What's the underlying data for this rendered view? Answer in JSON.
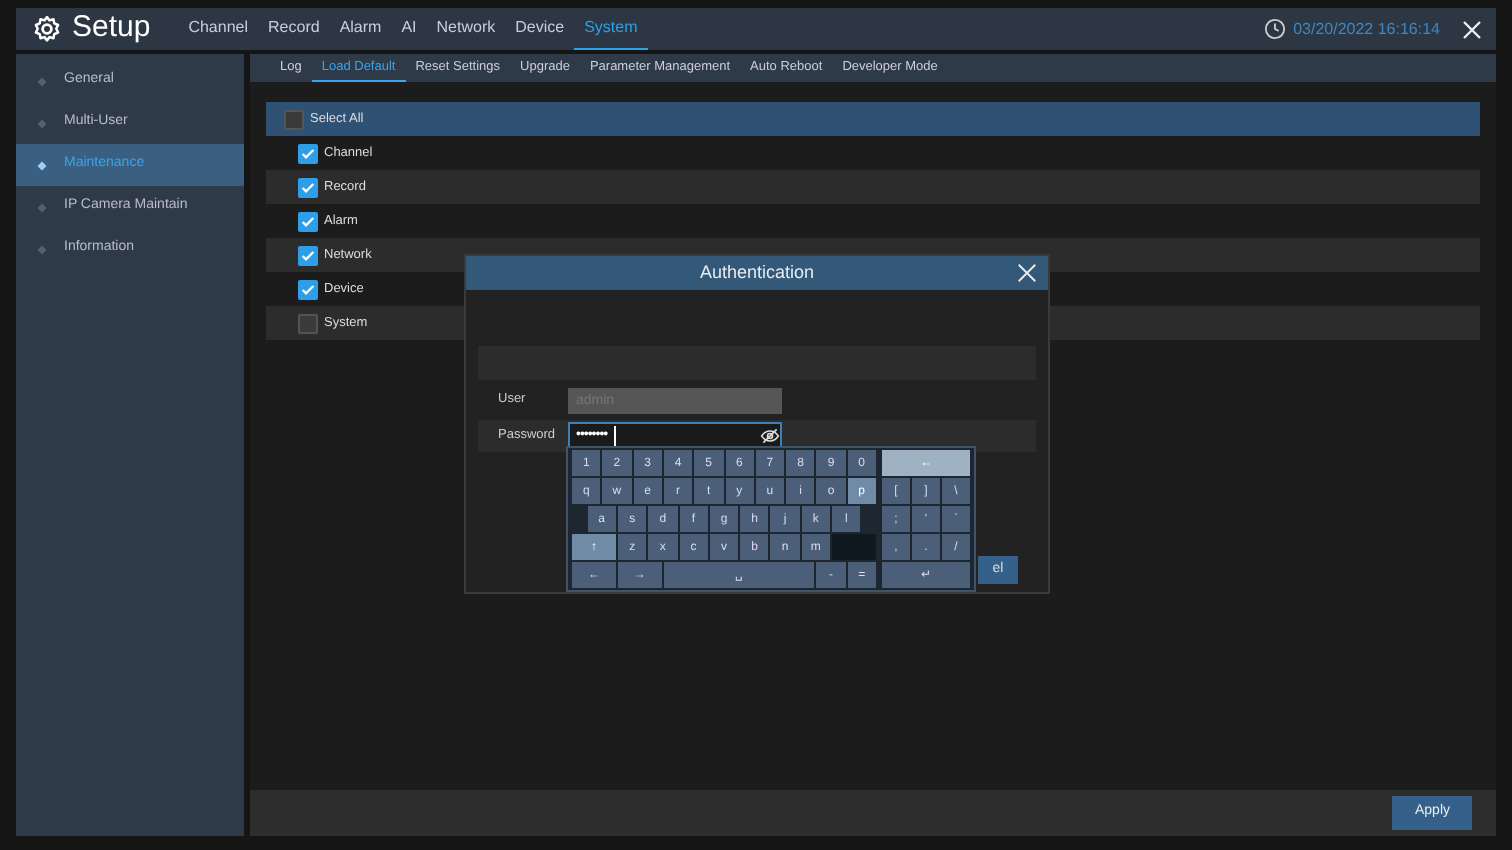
{
  "header": {
    "title": "Setup",
    "tabs": [
      {
        "label": "Channel",
        "selected": false
      },
      {
        "label": "Record",
        "selected": false
      },
      {
        "label": "Alarm",
        "selected": false
      },
      {
        "label": "AI",
        "selected": false
      },
      {
        "label": "Network",
        "selected": false
      },
      {
        "label": "Device",
        "selected": false
      },
      {
        "label": "System",
        "selected": true
      }
    ],
    "datetime": "03/20/2022 16:16:14"
  },
  "sidebar": {
    "items": [
      {
        "label": "General",
        "selected": false
      },
      {
        "label": "Multi-User",
        "selected": false
      },
      {
        "label": "Maintenance",
        "selected": true
      },
      {
        "label": "IP Camera Maintain",
        "selected": false
      },
      {
        "label": "Information",
        "selected": false
      }
    ]
  },
  "subtabs": [
    {
      "label": "Log",
      "selected": false
    },
    {
      "label": "Load Default",
      "selected": true
    },
    {
      "label": "Reset Settings",
      "selected": false
    },
    {
      "label": "Upgrade",
      "selected": false
    },
    {
      "label": "Parameter Management",
      "selected": false
    },
    {
      "label": "Auto Reboot",
      "selected": false
    },
    {
      "label": "Developer Mode",
      "selected": false
    }
  ],
  "options": [
    {
      "label": "Select All",
      "checked": false,
      "kind": "all"
    },
    {
      "label": "Channel",
      "checked": true,
      "kind": "item"
    },
    {
      "label": "Record",
      "checked": true,
      "kind": "item"
    },
    {
      "label": "Alarm",
      "checked": true,
      "kind": "item"
    },
    {
      "label": "Network",
      "checked": true,
      "kind": "item"
    },
    {
      "label": "Device",
      "checked": true,
      "kind": "item"
    },
    {
      "label": "System",
      "checked": false,
      "kind": "item"
    }
  ],
  "dialog": {
    "title": "Authentication",
    "user": {
      "label": "User",
      "value": "admin",
      "disabled": true
    },
    "password": {
      "label": "Password",
      "value": "••••••••",
      "disabled": false
    },
    "cancel_button": "el",
    "keyboard": {
      "left_rows": [
        [
          {
            "label": "1",
            "kind": "char",
            "highlighted": false
          },
          {
            "label": "2",
            "kind": "char",
            "highlighted": false
          },
          {
            "label": "3",
            "kind": "char",
            "highlighted": false
          },
          {
            "label": "4",
            "kind": "char",
            "highlighted": false
          },
          {
            "label": "5",
            "kind": "char",
            "highlighted": false
          },
          {
            "label": "6",
            "kind": "char",
            "highlighted": false
          },
          {
            "label": "7",
            "kind": "char",
            "highlighted": false
          },
          {
            "label": "8",
            "kind": "char",
            "highlighted": false
          },
          {
            "label": "9",
            "kind": "char",
            "highlighted": false
          },
          {
            "label": "0",
            "kind": "char",
            "highlighted": false
          }
        ],
        [
          {
            "label": "q",
            "kind": "char",
            "highlighted": false
          },
          {
            "label": "w",
            "kind": "char",
            "highlighted": false
          },
          {
            "label": "e",
            "kind": "char",
            "highlighted": false
          },
          {
            "label": "r",
            "kind": "char",
            "highlighted": false
          },
          {
            "label": "t",
            "kind": "char",
            "highlighted": false
          },
          {
            "label": "y",
            "kind": "char",
            "highlighted": false
          },
          {
            "label": "u",
            "kind": "char",
            "highlighted": false
          },
          {
            "label": "i",
            "kind": "char",
            "highlighted": false
          },
          {
            "label": "o",
            "kind": "char",
            "highlighted": false
          },
          {
            "label": "p",
            "kind": "char",
            "highlighted": true
          }
        ],
        [
          {
            "kind": "gap"
          },
          {
            "label": "a",
            "kind": "char",
            "highlighted": false
          },
          {
            "label": "s",
            "kind": "char",
            "highlighted": false
          },
          {
            "label": "d",
            "kind": "char",
            "highlighted": false
          },
          {
            "label": "f",
            "kind": "char",
            "highlighted": false
          },
          {
            "label": "g",
            "kind": "char",
            "highlighted": false
          },
          {
            "label": "h",
            "kind": "char",
            "highlighted": false
          },
          {
            "label": "j",
            "kind": "char",
            "highlighted": false
          },
          {
            "label": "k",
            "kind": "char",
            "highlighted": false
          },
          {
            "label": "l",
            "kind": "char",
            "highlighted": false
          },
          {
            "kind": "gap"
          }
        ],
        [
          {
            "label": "↑",
            "kind": "shift",
            "highlighted": true
          },
          {
            "label": "z",
            "kind": "char",
            "highlighted": false
          },
          {
            "label": "x",
            "kind": "char",
            "highlighted": false
          },
          {
            "label": "c",
            "kind": "char",
            "highlighted": false
          },
          {
            "label": "v",
            "kind": "char",
            "highlighted": false
          },
          {
            "label": "b",
            "kind": "char",
            "highlighted": false
          },
          {
            "label": "n",
            "kind": "char",
            "highlighted": false
          },
          {
            "label": "m",
            "kind": "char",
            "highlighted": false
          },
          {
            "kind": "blank"
          }
        ],
        [
          {
            "label": "←",
            "kind": "arrow",
            "highlighted": false
          },
          {
            "label": "→",
            "kind": "arrow",
            "highlighted": false
          },
          {
            "label": "␣",
            "kind": "space",
            "highlighted": false
          },
          {
            "label": "-",
            "kind": "char",
            "highlighted": false
          },
          {
            "label": "=",
            "kind": "char",
            "highlighted": false
          }
        ]
      ],
      "right_rows": [
        [
          {
            "label": "←",
            "kind": "wide",
            "highlighted": true
          }
        ],
        [
          {
            "label": "[",
            "kind": "char",
            "highlighted": false
          },
          {
            "label": "]",
            "kind": "char",
            "highlighted": false
          },
          {
            "label": "\\",
            "kind": "char",
            "highlighted": false
          }
        ],
        [
          {
            "label": ";",
            "kind": "char",
            "highlighted": false
          },
          {
            "label": "'",
            "kind": "char",
            "highlighted": false
          },
          {
            "label": "`",
            "kind": "char",
            "highlighted": false
          }
        ],
        [
          {
            "label": ",",
            "kind": "char",
            "highlighted": false
          },
          {
            "label": ".",
            "kind": "char",
            "highlighted": false
          },
          {
            "label": "/",
            "kind": "char",
            "highlighted": false
          }
        ],
        [
          {
            "label": "↵",
            "kind": "wide",
            "highlighted": false
          }
        ]
      ]
    }
  },
  "apply_button": "Apply"
}
